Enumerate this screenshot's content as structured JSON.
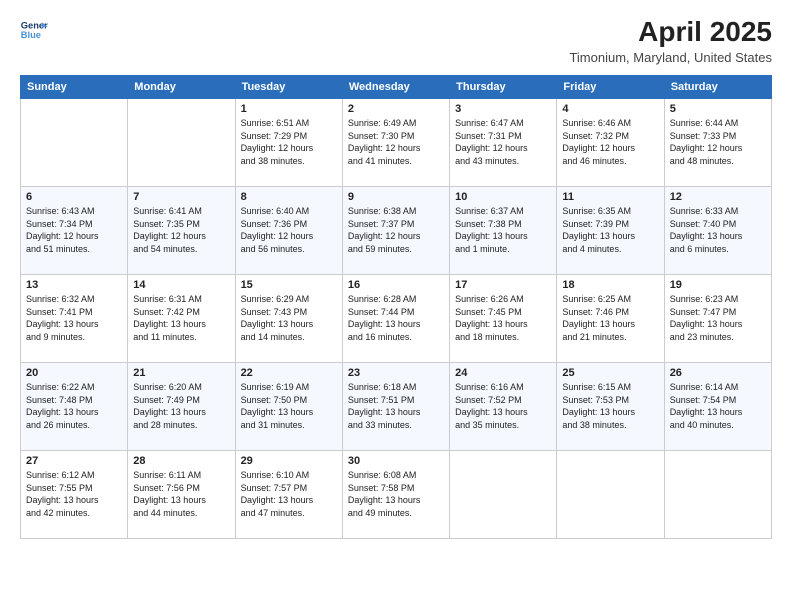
{
  "logo": {
    "line1": "General",
    "line2": "Blue",
    "icon_color": "#4a90d9"
  },
  "title": "April 2025",
  "subtitle": "Timonium, Maryland, United States",
  "days_of_week": [
    "Sunday",
    "Monday",
    "Tuesday",
    "Wednesday",
    "Thursday",
    "Friday",
    "Saturday"
  ],
  "weeks": [
    [
      {
        "day": "",
        "text": ""
      },
      {
        "day": "",
        "text": ""
      },
      {
        "day": "1",
        "text": "Sunrise: 6:51 AM\nSunset: 7:29 PM\nDaylight: 12 hours\nand 38 minutes."
      },
      {
        "day": "2",
        "text": "Sunrise: 6:49 AM\nSunset: 7:30 PM\nDaylight: 12 hours\nand 41 minutes."
      },
      {
        "day": "3",
        "text": "Sunrise: 6:47 AM\nSunset: 7:31 PM\nDaylight: 12 hours\nand 43 minutes."
      },
      {
        "day": "4",
        "text": "Sunrise: 6:46 AM\nSunset: 7:32 PM\nDaylight: 12 hours\nand 46 minutes."
      },
      {
        "day": "5",
        "text": "Sunrise: 6:44 AM\nSunset: 7:33 PM\nDaylight: 12 hours\nand 48 minutes."
      }
    ],
    [
      {
        "day": "6",
        "text": "Sunrise: 6:43 AM\nSunset: 7:34 PM\nDaylight: 12 hours\nand 51 minutes."
      },
      {
        "day": "7",
        "text": "Sunrise: 6:41 AM\nSunset: 7:35 PM\nDaylight: 12 hours\nand 54 minutes."
      },
      {
        "day": "8",
        "text": "Sunrise: 6:40 AM\nSunset: 7:36 PM\nDaylight: 12 hours\nand 56 minutes."
      },
      {
        "day": "9",
        "text": "Sunrise: 6:38 AM\nSunset: 7:37 PM\nDaylight: 12 hours\nand 59 minutes."
      },
      {
        "day": "10",
        "text": "Sunrise: 6:37 AM\nSunset: 7:38 PM\nDaylight: 13 hours\nand 1 minute."
      },
      {
        "day": "11",
        "text": "Sunrise: 6:35 AM\nSunset: 7:39 PM\nDaylight: 13 hours\nand 4 minutes."
      },
      {
        "day": "12",
        "text": "Sunrise: 6:33 AM\nSunset: 7:40 PM\nDaylight: 13 hours\nand 6 minutes."
      }
    ],
    [
      {
        "day": "13",
        "text": "Sunrise: 6:32 AM\nSunset: 7:41 PM\nDaylight: 13 hours\nand 9 minutes."
      },
      {
        "day": "14",
        "text": "Sunrise: 6:31 AM\nSunset: 7:42 PM\nDaylight: 13 hours\nand 11 minutes."
      },
      {
        "day": "15",
        "text": "Sunrise: 6:29 AM\nSunset: 7:43 PM\nDaylight: 13 hours\nand 14 minutes."
      },
      {
        "day": "16",
        "text": "Sunrise: 6:28 AM\nSunset: 7:44 PM\nDaylight: 13 hours\nand 16 minutes."
      },
      {
        "day": "17",
        "text": "Sunrise: 6:26 AM\nSunset: 7:45 PM\nDaylight: 13 hours\nand 18 minutes."
      },
      {
        "day": "18",
        "text": "Sunrise: 6:25 AM\nSunset: 7:46 PM\nDaylight: 13 hours\nand 21 minutes."
      },
      {
        "day": "19",
        "text": "Sunrise: 6:23 AM\nSunset: 7:47 PM\nDaylight: 13 hours\nand 23 minutes."
      }
    ],
    [
      {
        "day": "20",
        "text": "Sunrise: 6:22 AM\nSunset: 7:48 PM\nDaylight: 13 hours\nand 26 minutes."
      },
      {
        "day": "21",
        "text": "Sunrise: 6:20 AM\nSunset: 7:49 PM\nDaylight: 13 hours\nand 28 minutes."
      },
      {
        "day": "22",
        "text": "Sunrise: 6:19 AM\nSunset: 7:50 PM\nDaylight: 13 hours\nand 31 minutes."
      },
      {
        "day": "23",
        "text": "Sunrise: 6:18 AM\nSunset: 7:51 PM\nDaylight: 13 hours\nand 33 minutes."
      },
      {
        "day": "24",
        "text": "Sunrise: 6:16 AM\nSunset: 7:52 PM\nDaylight: 13 hours\nand 35 minutes."
      },
      {
        "day": "25",
        "text": "Sunrise: 6:15 AM\nSunset: 7:53 PM\nDaylight: 13 hours\nand 38 minutes."
      },
      {
        "day": "26",
        "text": "Sunrise: 6:14 AM\nSunset: 7:54 PM\nDaylight: 13 hours\nand 40 minutes."
      }
    ],
    [
      {
        "day": "27",
        "text": "Sunrise: 6:12 AM\nSunset: 7:55 PM\nDaylight: 13 hours\nand 42 minutes."
      },
      {
        "day": "28",
        "text": "Sunrise: 6:11 AM\nSunset: 7:56 PM\nDaylight: 13 hours\nand 44 minutes."
      },
      {
        "day": "29",
        "text": "Sunrise: 6:10 AM\nSunset: 7:57 PM\nDaylight: 13 hours\nand 47 minutes."
      },
      {
        "day": "30",
        "text": "Sunrise: 6:08 AM\nSunset: 7:58 PM\nDaylight: 13 hours\nand 49 minutes."
      },
      {
        "day": "",
        "text": ""
      },
      {
        "day": "",
        "text": ""
      },
      {
        "day": "",
        "text": ""
      }
    ]
  ]
}
